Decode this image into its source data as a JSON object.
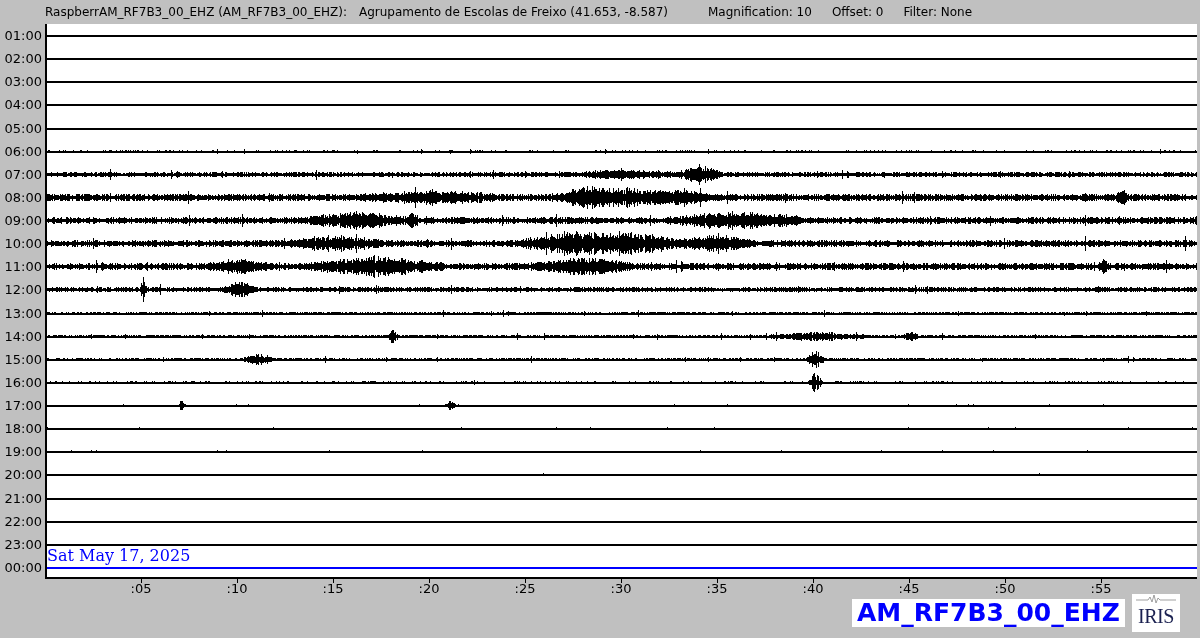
{
  "header": {
    "station": "RaspberrAM_RF7B3_00_EHZ (AM_RF7B3_00_EHZ):",
    "location": "Agrupamento de Escolas de Freixo (41.653, -8.587)",
    "magnification": "Magnification: 10",
    "offset": "Offset: 0",
    "filter": "Filter: None"
  },
  "rows": [
    {
      "label": "01:00",
      "color": "#000000"
    },
    {
      "label": "02:00",
      "color": "#000000"
    },
    {
      "label": "03:00",
      "color": "#000000"
    },
    {
      "label": "04:00",
      "color": "#000000"
    },
    {
      "label": "05:00",
      "color": "#000000"
    },
    {
      "label": "06:00",
      "color": "#000000"
    },
    {
      "label": "07:00",
      "color": "#000000"
    },
    {
      "label": "08:00",
      "color": "#000000"
    },
    {
      "label": "09:00",
      "color": "#000000"
    },
    {
      "label": "10:00",
      "color": "#000000"
    },
    {
      "label": "11:00",
      "color": "#000000"
    },
    {
      "label": "12:00",
      "color": "#000000"
    },
    {
      "label": "13:00",
      "color": "#000000"
    },
    {
      "label": "14:00",
      "color": "#000000"
    },
    {
      "label": "15:00",
      "color": "#000000"
    },
    {
      "label": "16:00",
      "color": "#000000"
    },
    {
      "label": "17:00",
      "color": "#000000"
    },
    {
      "label": "18:00",
      "color": "#000000"
    },
    {
      "label": "19:00",
      "color": "#000000"
    },
    {
      "label": "20:00",
      "color": "#000000"
    },
    {
      "label": "21:00",
      "color": "#000000"
    },
    {
      "label": "22:00",
      "color": "#000000"
    },
    {
      "label": "23:00",
      "color": "#000000"
    },
    {
      "label": "00:00",
      "color": "#0000ff"
    }
  ],
  "date_label": "Sat May 17, 2025",
  "minute_ticks": [
    ":05",
    ":10",
    ":15",
    ":20",
    ":25",
    ":30",
    ":35",
    ":40",
    ":45",
    ":50",
    ":55"
  ],
  "channel_badge": "AM_RF7B3_00_EHZ",
  "logo": {
    "text": "IRIS"
  }
}
